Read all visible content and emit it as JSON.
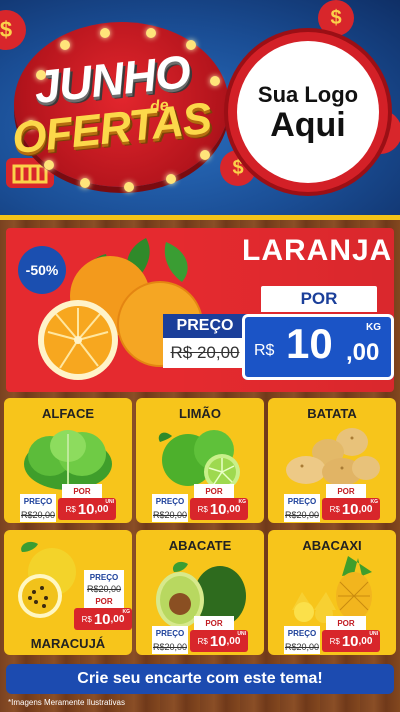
{
  "header": {
    "title_line1": "JUNHO",
    "title_de": "de",
    "title_line2": "OFERTAS",
    "logo_line1": "Sua Logo",
    "logo_line2": "Aqui",
    "coin_symbol": "$"
  },
  "featured": {
    "discount": "-50%",
    "name": "LARANJA",
    "preco_label": "PREÇO",
    "old_price": "R$ 20,00",
    "por_label": "POR",
    "currency": "R$",
    "price_int": "10",
    "price_dec": ",00",
    "unit": "KG"
  },
  "products": [
    {
      "name": "ALFACE",
      "preco_label": "PREÇO",
      "old_price": "R$20,00",
      "por_label": "POR",
      "currency": "R$",
      "price_int": "10",
      "price_dec": ",00",
      "unit": "UNI"
    },
    {
      "name": "LIMÃO",
      "preco_label": "PREÇO",
      "old_price": "R$20,00",
      "por_label": "POR",
      "currency": "R$",
      "price_int": "10",
      "price_dec": ",00",
      "unit": "KG"
    },
    {
      "name": "BATATA",
      "preco_label": "PREÇO",
      "old_price": "R$20,00",
      "por_label": "POR",
      "currency": "R$",
      "price_int": "10",
      "price_dec": ",00",
      "unit": "KG"
    },
    {
      "name": "MARACUJÁ",
      "preco_label": "PREÇO",
      "old_price": "R$20,00",
      "por_label": "POR",
      "currency": "R$",
      "price_int": "10",
      "price_dec": ",00",
      "unit": "KG"
    },
    {
      "name": "ABACATE",
      "preco_label": "PREÇO",
      "old_price": "R$20,00",
      "por_label": "POR",
      "currency": "R$",
      "price_int": "10",
      "price_dec": ",00",
      "unit": "UNI"
    },
    {
      "name": "ABACAXI",
      "preco_label": "PREÇO",
      "old_price": "R$20,00",
      "por_label": "POR",
      "currency": "R$",
      "price_int": "10",
      "price_dec": ",00",
      "unit": "UNI"
    }
  ],
  "footer": {
    "cta": "Crie seu encarte com este tema!",
    "disclaimer": "*Imagens Meramente Ilustrativas"
  },
  "colors": {
    "brand_red": "#e52a2f",
    "brand_blue": "#1b54c6",
    "card_yellow": "#f7c51b"
  }
}
